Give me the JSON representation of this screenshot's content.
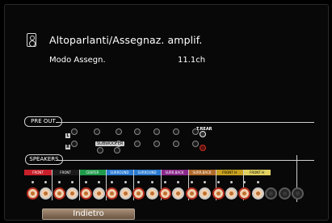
{
  "header": {
    "title": "Altoparlanti/Assegnaz. amplif.",
    "icon": "speaker-icon"
  },
  "mode": {
    "label": "Modo Assegn.",
    "value": "11.1ch"
  },
  "diagram": {
    "pre_out_label": "PRE OUT",
    "speakers_label": "SPEAKERS",
    "subwoofer_label": "SUBWOOFER",
    "trear_label": "T.REAR",
    "lr_labels": {
      "l": "L",
      "r": "R"
    },
    "channels": [
      {
        "label": "FRONT",
        "color": "#c8202a"
      },
      {
        "label": "FRONT",
        "color": "#1a1a1a"
      },
      {
        "label": "CENTER",
        "color": "#1f9a4a"
      },
      {
        "label": "SURROUND",
        "color": "#2a7ad0"
      },
      {
        "label": "SURROUND",
        "color": "#2a7ad0"
      },
      {
        "label": "SURR.BACK",
        "color": "#8b2a8a"
      },
      {
        "label": "SURR.BACK",
        "color": "#b06a2a"
      },
      {
        "label": "FRONT H",
        "color": "#c8a020"
      },
      {
        "label": "FRONT H",
        "color": "#e0d060"
      }
    ]
  },
  "footer": {
    "back_label": "Indietro"
  }
}
